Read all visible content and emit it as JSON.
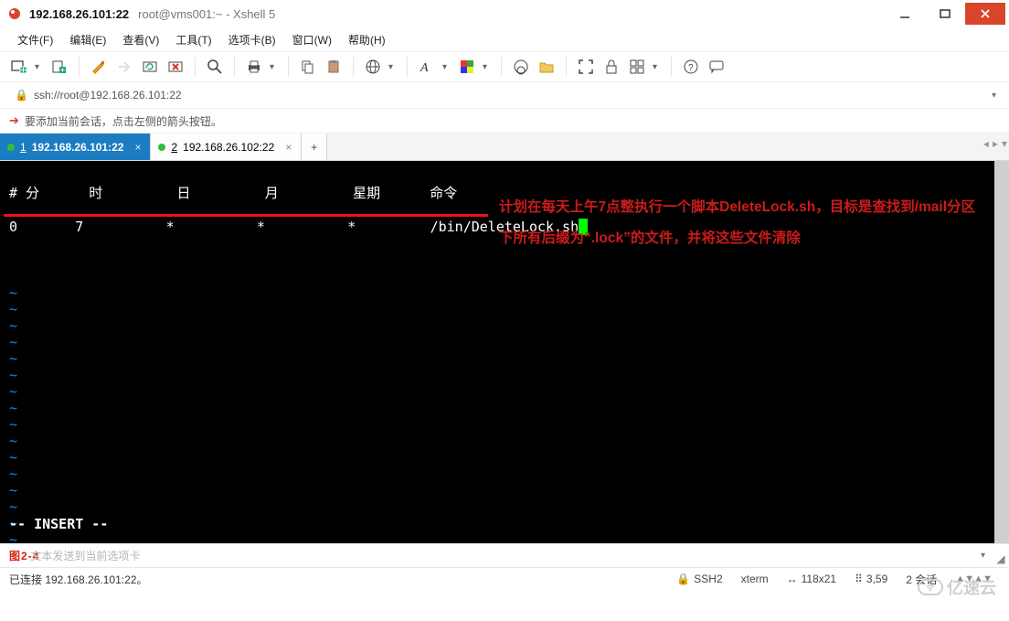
{
  "window": {
    "title_bold": "192.168.26.101:22",
    "title_rest": "root@vms001:~ - Xshell 5"
  },
  "menu": {
    "file": "文件(F)",
    "edit": "编辑(E)",
    "view": "查看(V)",
    "tools": "工具(T)",
    "tab": "选项卡(B)",
    "window": "窗口(W)",
    "help": "帮助(H)"
  },
  "icons": {
    "new": "new-session-icon",
    "open": "open-icon",
    "brush": "properties-icon",
    "arrow": "forward-icon",
    "reload": "reconnect-icon",
    "disconnect": "disconnect-icon",
    "search": "find-icon",
    "print": "print-icon",
    "copy": "copy-icon",
    "paste": "paste-icon",
    "globe": "encoding-icon",
    "font": "font-icon",
    "color": "color-icon",
    "swirl": "session-icon",
    "folder": "folder-icon",
    "fs": "fullscreen-icon",
    "lock": "lock-icon",
    "grid": "tile-icon",
    "help": "help-icon",
    "chat": "chat-icon"
  },
  "address": {
    "url": "ssh://root@192.168.26.101:22"
  },
  "hint": {
    "text": "要添加当前会话，点击左侧的箭头按钮。"
  },
  "tabs": [
    {
      "num": "1",
      "label": "192.168.26.101:22",
      "active": true
    },
    {
      "num": "2",
      "label": "192.168.26.102:22",
      "active": false
    }
  ],
  "terminal": {
    "header": "# 分      时         日         月         星期      命令",
    "cron": "0       7          *          *          *         /bin/DeleteLock.sh",
    "mode": "-- INSERT --",
    "annotation": "计划在每天上午7点整执行一个脚本DeleteLock.sh，目标是查找到/mail分区下所有后缀为“.lock”的文件，并将这些文件清除"
  },
  "figure_label": "图2-4",
  "input_placeholder": "文本发送到当前选项卡",
  "status": {
    "conn": "已连接 192.168.26.101:22。",
    "proto": "SSH2",
    "term": "xterm",
    "size": "118x21",
    "pos": "3,59",
    "sess": "2 会话"
  },
  "watermark": "亿速云"
}
